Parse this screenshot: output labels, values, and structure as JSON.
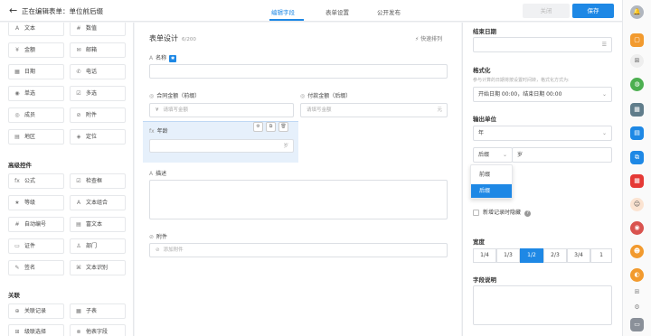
{
  "header": {
    "title_prefix": "正在编辑表单：",
    "title_name": "单位前后缀",
    "tabs": [
      "编辑字段",
      "表单设置",
      "公开发布"
    ],
    "close_label": "关闭",
    "save_label": "保存"
  },
  "palette": {
    "basic": [
      "文本",
      "数值",
      "金额",
      "邮箱",
      "日期",
      "电话",
      "单选",
      "多选",
      "成员",
      "附件",
      "地区",
      "定位"
    ],
    "basic_icons": [
      "A",
      "#",
      "¥",
      "✉",
      "▦",
      "✆",
      "◉",
      "☑",
      "◎",
      "⊘",
      "▤",
      "◈"
    ],
    "advanced_title": "高级控件",
    "advanced": [
      "公式",
      "检查框",
      "等级",
      "文本组合",
      "自动编号",
      "富文本",
      "证件",
      "部门",
      "签名",
      "文本识别"
    ],
    "advanced_icons": [
      "fx",
      "☑",
      "★",
      "A",
      "#",
      "▤",
      "▭",
      "♙",
      "✎",
      "⌘"
    ],
    "relation_title": "关联",
    "relation": [
      "关联记录",
      "子表",
      "级联选择",
      "他表字段"
    ],
    "relation_icons": [
      "⊕",
      "▦",
      "⊞",
      "⊗"
    ]
  },
  "canvas": {
    "title": "表单设计",
    "count": "6/200",
    "quick_label": "快速排列",
    "name_label": "名称",
    "contract_label": "合同金额（前缀）",
    "contract_placeholder": "请填写金额",
    "contract_prefix": "¥",
    "paid_label": "付款金额（后缀）",
    "paid_placeholder": "请填写金额",
    "paid_suffix": "元",
    "age_label": "年龄",
    "age_suffix": "岁",
    "desc_label": "描述",
    "attach_label": "附件",
    "attach_placeholder": "添加附件"
  },
  "props": {
    "end_date_label": "结束日期",
    "format_label": "格式化",
    "format_hint": "参与计算的日期将按设置时间转，格式化方式为:",
    "format_value": "开始日期 00:00，结束日期 00:00",
    "unit_label": "输出单位",
    "unit_value": "年",
    "affix_value": "后缀",
    "affix_text": "岁",
    "affix_options": [
      "前缀",
      "后缀"
    ],
    "hide_label": "新增记录时隐藏",
    "width_label": "宽度",
    "widths": [
      "1/4",
      "1/3",
      "1/2",
      "2/3",
      "3/4",
      "1"
    ],
    "width_selected": "1/2",
    "desc_label": "字段说明"
  },
  "colors": {
    "accent": "#1e88e5"
  }
}
